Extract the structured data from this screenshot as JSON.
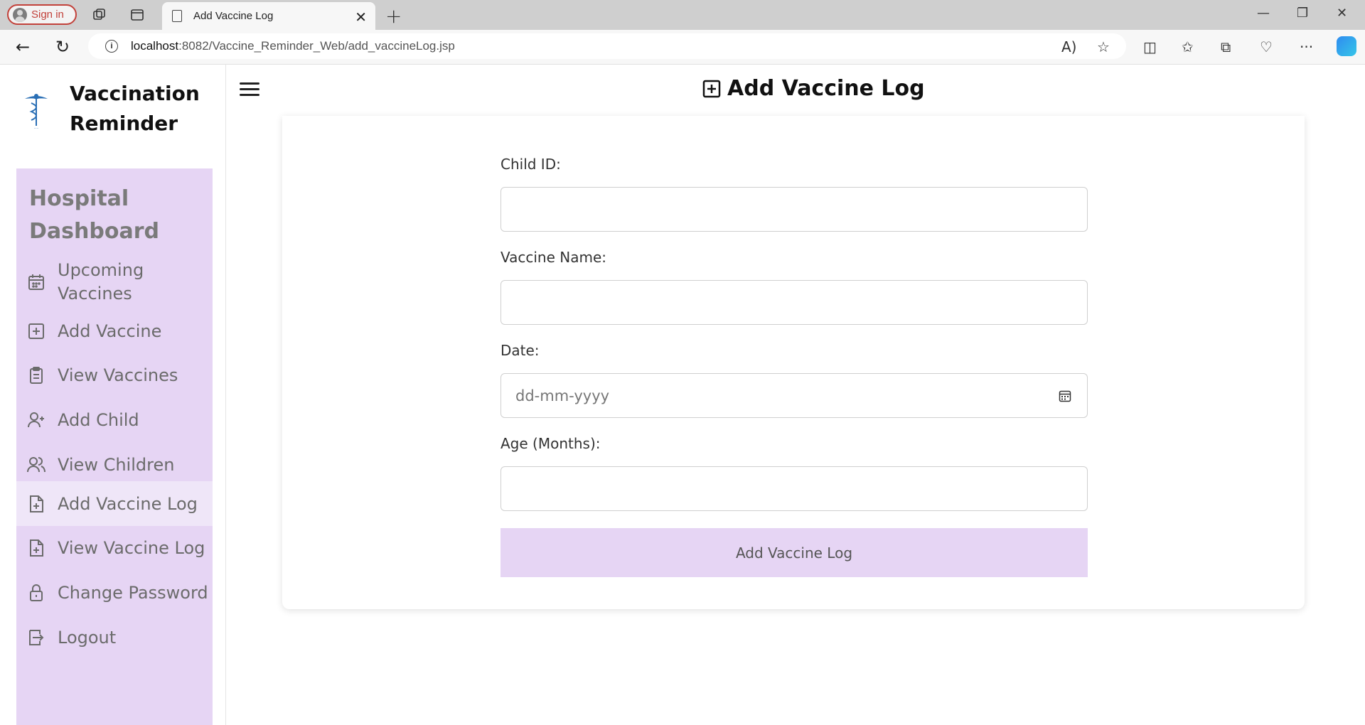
{
  "browser": {
    "signin_label": "Sign in",
    "tab_title": "Add Vaccine Log",
    "url_host": "localhost",
    "url_rest": ":8082/Vaccine_Reminder_Web/add_vaccineLog.jsp"
  },
  "brand": {
    "title_line1": "Vaccination",
    "title_line2": "Reminder"
  },
  "sidebar": {
    "heading_line1": "Hospital",
    "heading_line2": "Dashboard",
    "items": [
      {
        "label_line1": "Upcoming",
        "label_line2": "Vaccines",
        "icon": "calendar-icon"
      },
      {
        "label": "Add Vaccine",
        "icon": "plus-square-icon"
      },
      {
        "label": "View Vaccines",
        "icon": "clipboard-icon"
      },
      {
        "label": "Add Child",
        "icon": "user-plus-icon"
      },
      {
        "label": "View Children",
        "icon": "users-icon"
      },
      {
        "label": "Add Vaccine Log",
        "icon": "file-plus-icon",
        "active": true
      },
      {
        "label": "View Vaccine Log",
        "icon": "file-plus-icon"
      },
      {
        "label": "Change Password",
        "icon": "lock-icon"
      },
      {
        "label": "Logout",
        "icon": "logout-icon"
      }
    ]
  },
  "header": {
    "title": "Add Vaccine Log"
  },
  "form": {
    "child_id_label": "Child ID:",
    "child_id_value": "",
    "vaccine_name_label": "Vaccine Name:",
    "vaccine_name_value": "",
    "date_label": "Date:",
    "date_placeholder": "dd-mm-yyyy",
    "age_label": "Age (Months):",
    "age_value": "",
    "submit_label": "Add Vaccine Log"
  },
  "colors": {
    "sidebar_bg": "#e6d5f4",
    "active_item_bg": "#efe6f8",
    "button_bg": "#e6d5f4",
    "signin_accent": "#c2413a"
  }
}
